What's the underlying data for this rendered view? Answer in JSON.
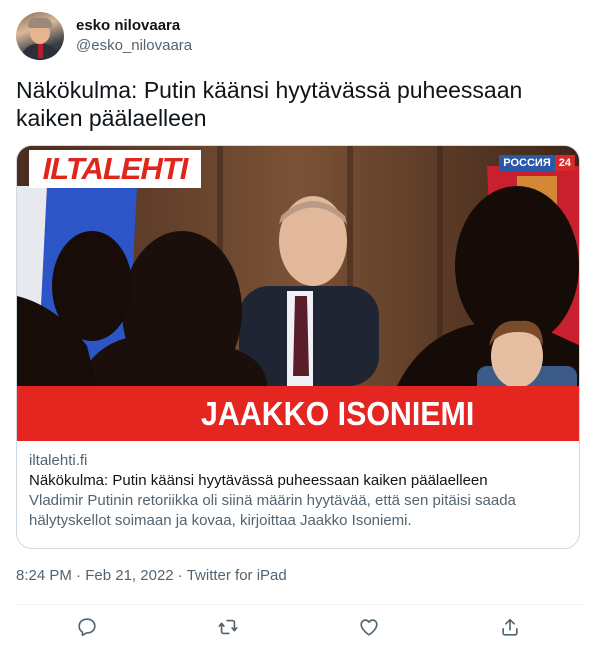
{
  "author": {
    "display_name": "esko nilovaara",
    "handle": "@esko_nilovaara"
  },
  "tweet": {
    "text": "Näkökulma: Putin käänsi hyytävässä puheessaan kaiken päälaelleen"
  },
  "card": {
    "image": {
      "logo_text": "ILTALEHTI",
      "channel_text_1": "РОССИЯ",
      "channel_text_2": "24",
      "banner_text": "JAAKKO ISONIEMI"
    },
    "domain": "iltalehti.fi",
    "title": "Näkökulma: Putin käänsi hyytävässä puheessaan kaiken päälaelleen",
    "description": "Vladimir Putinin retoriikka oli siinä määrin hyytävää, että sen pitäisi saada hälytyskellot soimaan ja kovaa, kirjoittaa Jaakko Isoniemi."
  },
  "meta": {
    "time": "8:24 PM",
    "date": "Feb 21, 2022",
    "source": "Twitter for iPad"
  },
  "actions": [
    {
      "name": "reply",
      "icon": "reply-icon"
    },
    {
      "name": "retweet",
      "icon": "retweet-icon"
    },
    {
      "name": "like",
      "icon": "heart-icon"
    },
    {
      "name": "share",
      "icon": "share-icon"
    }
  ],
  "colors": {
    "text": "#0f1419",
    "secondary": "#536471",
    "border": "#cfd9de",
    "brand_red": "#e52520"
  }
}
